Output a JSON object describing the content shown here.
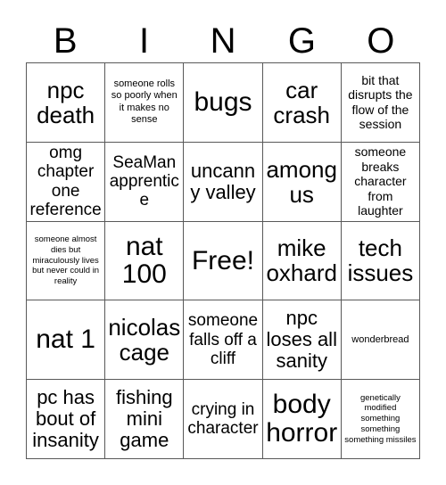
{
  "card": {
    "title": "BINGO",
    "header": {
      "letters": [
        "B",
        "I",
        "N",
        "G",
        "O"
      ]
    },
    "colors": {
      "background": "#ffffff",
      "cell_background": "#ffffff",
      "grid_line": "#595959",
      "text": "#000000"
    },
    "grid": {
      "columns": 5,
      "rows": 5,
      "free_space": "Free!",
      "free_space_position": {
        "row": 3,
        "column": 3
      },
      "cells": [
        [
          {
            "text": "npc death",
            "size": "xl"
          },
          {
            "text": "someone rolls so poorly when it makes no sense",
            "size": "xs"
          },
          {
            "text": "bugs",
            "size": "xxl"
          },
          {
            "text": "car crash",
            "size": "xl"
          },
          {
            "text": "bit that disrupts the flow of the session",
            "size": "sm"
          }
        ],
        [
          {
            "text": "omg chapter one reference",
            "size": "md"
          },
          {
            "text": "SeaMan apprentice",
            "size": "md"
          },
          {
            "text": "uncanny valley",
            "size": "lg"
          },
          {
            "text": "among us",
            "size": "xl"
          },
          {
            "text": "someone breaks character from laughter",
            "size": "sm"
          }
        ],
        [
          {
            "text": "someone almost dies but miraculously lives but never could in reality",
            "size": "xxs"
          },
          {
            "text": "nat 100",
            "size": "xxl"
          },
          {
            "text": "Free!",
            "size": "xxl"
          },
          {
            "text": "mike oxhard",
            "size": "xl"
          },
          {
            "text": "tech issues",
            "size": "xl"
          }
        ],
        [
          {
            "text": "nat 1",
            "size": "xxl"
          },
          {
            "text": "nicolas cage",
            "size": "xl"
          },
          {
            "text": "someone falls off a cliff",
            "size": "md"
          },
          {
            "text": "npc loses all sanity",
            "size": "lg"
          },
          {
            "text": "wonderbread",
            "size": "xs"
          }
        ],
        [
          {
            "text": "pc has bout of insanity",
            "size": "lg"
          },
          {
            "text": "fishing mini game",
            "size": "lg"
          },
          {
            "text": "crying in character",
            "size": "md"
          },
          {
            "text": "body horror",
            "size": "xxl"
          },
          {
            "text": "genetically modified something something something missiles",
            "size": "xxs"
          }
        ]
      ]
    }
  }
}
